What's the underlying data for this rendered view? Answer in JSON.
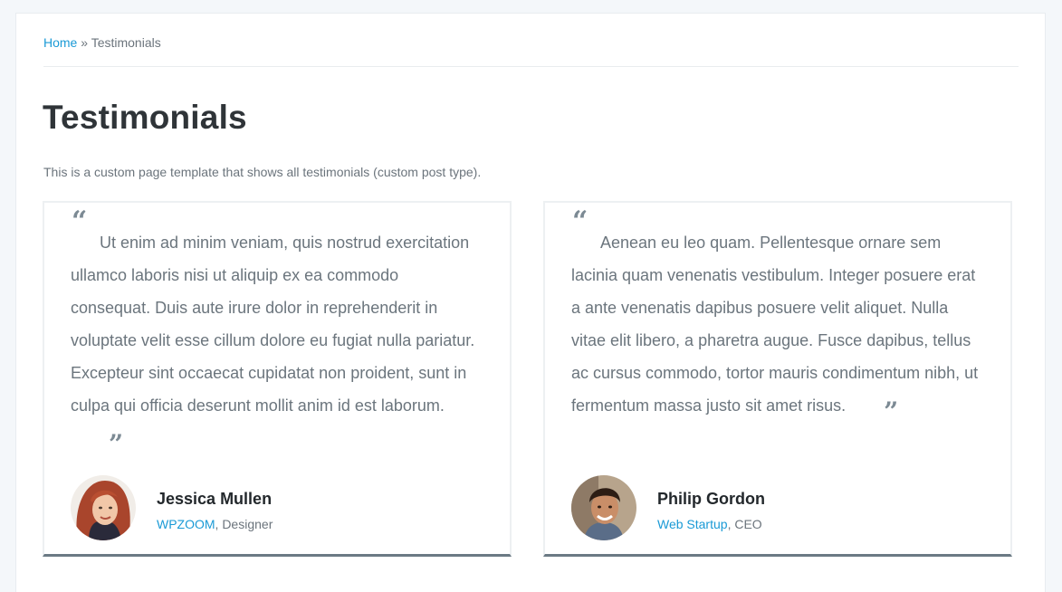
{
  "breadcrumb": {
    "home": "Home",
    "separator": "»",
    "current": "Testimonials"
  },
  "page": {
    "title": "Testimonials",
    "description": "This is a custom page template that shows all testimonials (custom post type)."
  },
  "quote_marks": {
    "open": "“",
    "close": "”"
  },
  "testimonials": [
    {
      "quote": "Ut enim ad minim veniam, quis nostrud exercitation ullamco laboris nisi ut aliquip ex ea commodo consequat. Duis aute irure dolor in reprehenderit in voluptate velit esse cillum dolore eu fugiat nulla pariatur. Excepteur sint occaecat cupidatat non proident, sunt in culpa qui officia deserunt mollit anim id est laborum.",
      "name": "Jessica Mullen",
      "company": "WPZOOM",
      "role": ", Designer"
    },
    {
      "quote": "Aenean eu leo quam. Pellentesque ornare sem lacinia quam venenatis vestibulum. Integer posuere erat a ante venenatis dapibus posuere velit aliquet. Nulla vitae elit libero, a pharetra augue. Fusce dapibus, tellus ac cursus commodo, tortor mauris condimentum nibh, ut fermentum massa justo sit amet risus.",
      "name": "Philip Gordon",
      "company": "Web Startup",
      "role": ", CEO"
    }
  ],
  "colors": {
    "link": "#1a9ad6",
    "card_bottom_border": "#6b7a84",
    "background": "#f4f7fa"
  }
}
